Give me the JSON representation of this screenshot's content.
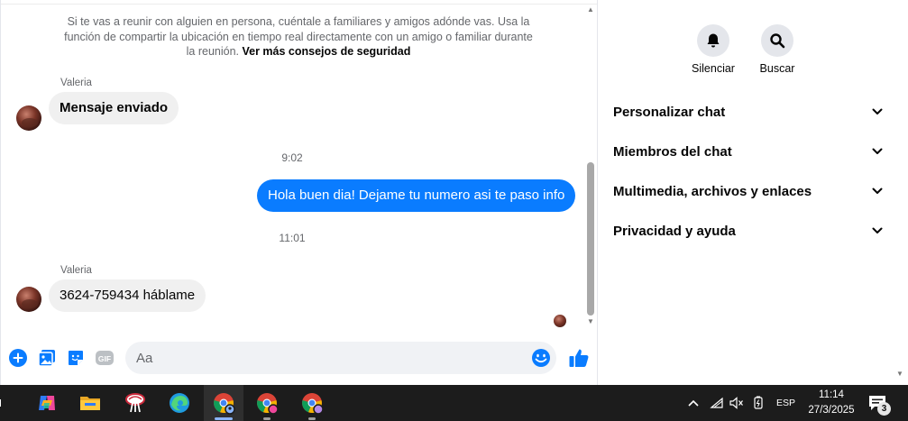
{
  "colors": {
    "accent": "#0a7cff",
    "bubble_in": "#f0f0f0",
    "taskbar": "#1c1c1c"
  },
  "chat": {
    "safety_notice": "Si te vas a reunir con alguien en persona, cuéntale a familiares y amigos adónde vas. Usa la función de compartir la ubicación en tiempo real directamente con un amigo o familiar durante la reunión.",
    "safety_link": "Ver más consejos de seguridad",
    "messages": [
      {
        "sender": "Valeria",
        "text": "Mensaje enviado",
        "direction": "in"
      },
      {
        "time": "9:02"
      },
      {
        "text": "Hola buen dia! Dejame tu numero asi te paso info",
        "direction": "out"
      },
      {
        "time": "11:01"
      },
      {
        "sender": "Valeria",
        "text": "3624-759434 háblame",
        "direction": "in"
      }
    ]
  },
  "composer": {
    "placeholder": "Aa",
    "icons": [
      "plus-icon",
      "gallery-icon",
      "sticker-icon",
      "gif-icon",
      "emoji-icon",
      "thumbs-up-icon"
    ],
    "gif_label": "GIF"
  },
  "info_panel": {
    "actions": [
      {
        "label": "Silenciar",
        "icon": "bell-icon"
      },
      {
        "label": "Buscar",
        "icon": "search-icon"
      }
    ],
    "sections": [
      {
        "title": "Personalizar chat"
      },
      {
        "title": "Miembros del chat"
      },
      {
        "title": "Multimedia, archivos y enlaces"
      },
      {
        "title": "Privacidad y ayuda"
      }
    ]
  },
  "taskbar": {
    "apps": [
      "copilot-icon",
      "file-explorer-icon",
      "photo-app-icon",
      "edge-icon",
      "chrome-profile-1-icon",
      "chrome-profile-2-icon",
      "chrome-profile-3-icon"
    ],
    "language": "ESP",
    "time": "11:14",
    "date": "27/3/2025",
    "notifications": "3"
  }
}
